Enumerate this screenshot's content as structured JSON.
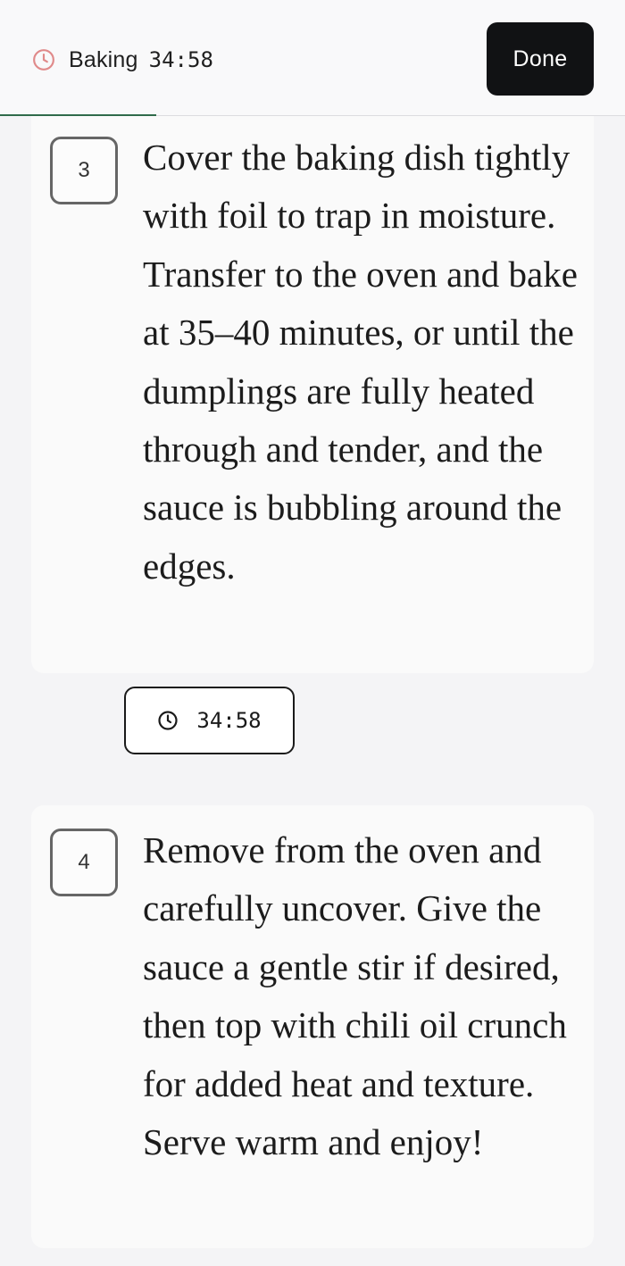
{
  "header": {
    "status_label": "Baking",
    "timer": "34:58",
    "done_label": "Done",
    "progress": 0.25,
    "status_icon": "clock-icon",
    "status_icon_color": "#e08a8a"
  },
  "steps": [
    {
      "number": "3",
      "text": "Cover the baking dish tightly with foil to trap in moisture. Transfer to the oven and bake at 35–40 minutes, or until the dumplings are fully heated through and tender, and the sauce is bubbling around the edges."
    },
    {
      "number": "4",
      "text": "Remove from the oven and carefully uncover. Give the sauce a gentle stir if desired, then top with chili oil crunch for added heat and texture. Serve warm and enjoy!"
    }
  ],
  "step_timer": {
    "time": "34:58",
    "icon": "clock-icon"
  },
  "colors": {
    "accent": "#2f6b4a",
    "button_bg": "#111214",
    "background": "#f4f4f6"
  }
}
